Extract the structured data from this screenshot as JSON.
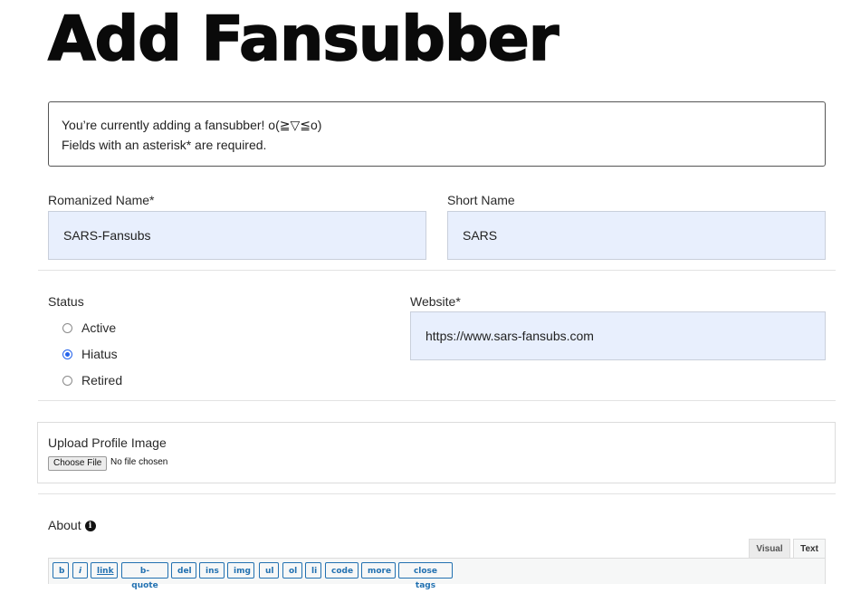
{
  "page": {
    "title": "Add Fansubber"
  },
  "notice": {
    "line1": "You’re currently adding a fansubber! o(≧▽≦o)",
    "line2": "Fields with an asterisk* are required."
  },
  "fields": {
    "romanized_name": {
      "label": "Romanized Name*",
      "value": "SARS-Fansubs"
    },
    "short_name": {
      "label": "Short Name",
      "value": "SARS"
    },
    "status": {
      "label": "Status",
      "options": [
        {
          "label": "Active",
          "checked": false
        },
        {
          "label": "Hiatus",
          "checked": true
        },
        {
          "label": "Retired",
          "checked": false
        }
      ]
    },
    "website": {
      "label": "Website*",
      "value": "https://www.sars-fansubs.com"
    },
    "profile_image": {
      "label": "Upload Profile Image",
      "button_label": "Choose File",
      "status_text": "No file chosen"
    },
    "about": {
      "label": "About",
      "info_icon": "info-circle-icon"
    }
  },
  "editor": {
    "tabs": [
      "Visual",
      "Text"
    ],
    "active_tab": "Text",
    "quicktags": [
      "b",
      "i",
      "link",
      "b-quote",
      "del",
      "ins",
      "img",
      "ul",
      "ol",
      "li",
      "code",
      "more",
      "close tags"
    ]
  },
  "colors": {
    "input_bg": "#e8effd",
    "radio_checked": "#2563eb",
    "quicktag_blue": "#2271b1"
  }
}
